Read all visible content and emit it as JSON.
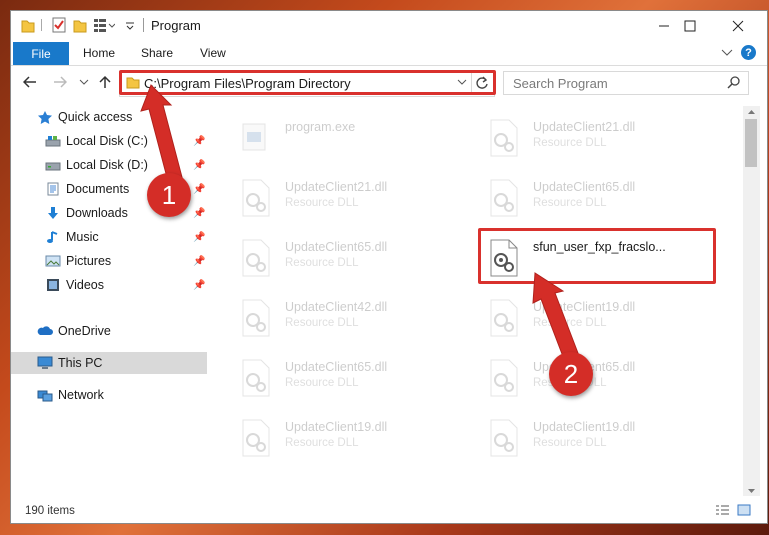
{
  "window": {
    "title": "Program",
    "controls": [
      "minimize",
      "maximize",
      "close"
    ]
  },
  "ribbon": {
    "tabs": [
      "File",
      "Home",
      "Share",
      "View"
    ]
  },
  "address": {
    "path": "C:\\Program Files\\Program Directory"
  },
  "search": {
    "placeholder": "Search Program"
  },
  "nav": {
    "quick_access": "Quick access",
    "items": [
      {
        "label": "Local Disk (C:)",
        "icon": "drive-icon",
        "pinned": true
      },
      {
        "label": "Local Disk (D:)",
        "icon": "drive-icon",
        "pinned": true
      },
      {
        "label": "Documents",
        "icon": "documents-icon",
        "pinned": true
      },
      {
        "label": "Downloads",
        "icon": "downloads-icon",
        "pinned": true
      },
      {
        "label": "Music",
        "icon": "music-icon",
        "pinned": true
      },
      {
        "label": "Pictures",
        "icon": "pictures-icon",
        "pinned": true
      },
      {
        "label": "Videos",
        "icon": "videos-icon",
        "pinned": true
      }
    ],
    "onedrive": "OneDrive",
    "this_pc": "This PC",
    "network": "Network"
  },
  "files": [
    {
      "name": "program.exe",
      "type": "",
      "faded": true
    },
    {
      "name": "UpdateClient21.dll",
      "type": "Resource DLL",
      "faded": true
    },
    {
      "name": "UpdateClient21.dll",
      "type": "Resource DLL",
      "faded": true
    },
    {
      "name": "UpdateClient65.dll",
      "type": "Resource DLL",
      "faded": true
    },
    {
      "name": "UpdateClient65.dll",
      "type": "Resource DLL",
      "faded": true
    },
    {
      "name": "sfun_user_fxp_fracslo...",
      "type": "",
      "faded": false
    },
    {
      "name": "UpdateClient42.dll",
      "type": "Resource DLL",
      "faded": true
    },
    {
      "name": "UpdateClient19.dll",
      "type": "Resource DLL",
      "faded": true
    },
    {
      "name": "UpdateClient65.dll",
      "type": "Resource DLL",
      "faded": true
    },
    {
      "name": "UpdateClient65.dll",
      "type": "Resource DLL",
      "faded": true
    },
    {
      "name": "UpdateClient19.dll",
      "type": "Resource DLL",
      "faded": true
    },
    {
      "name": "UpdateClient19.dll",
      "type": "Resource DLL",
      "faded": true
    }
  ],
  "status": {
    "item_count": "190 items"
  },
  "annotations": {
    "step1": "1",
    "step2": "2",
    "color": "#d9312d"
  }
}
